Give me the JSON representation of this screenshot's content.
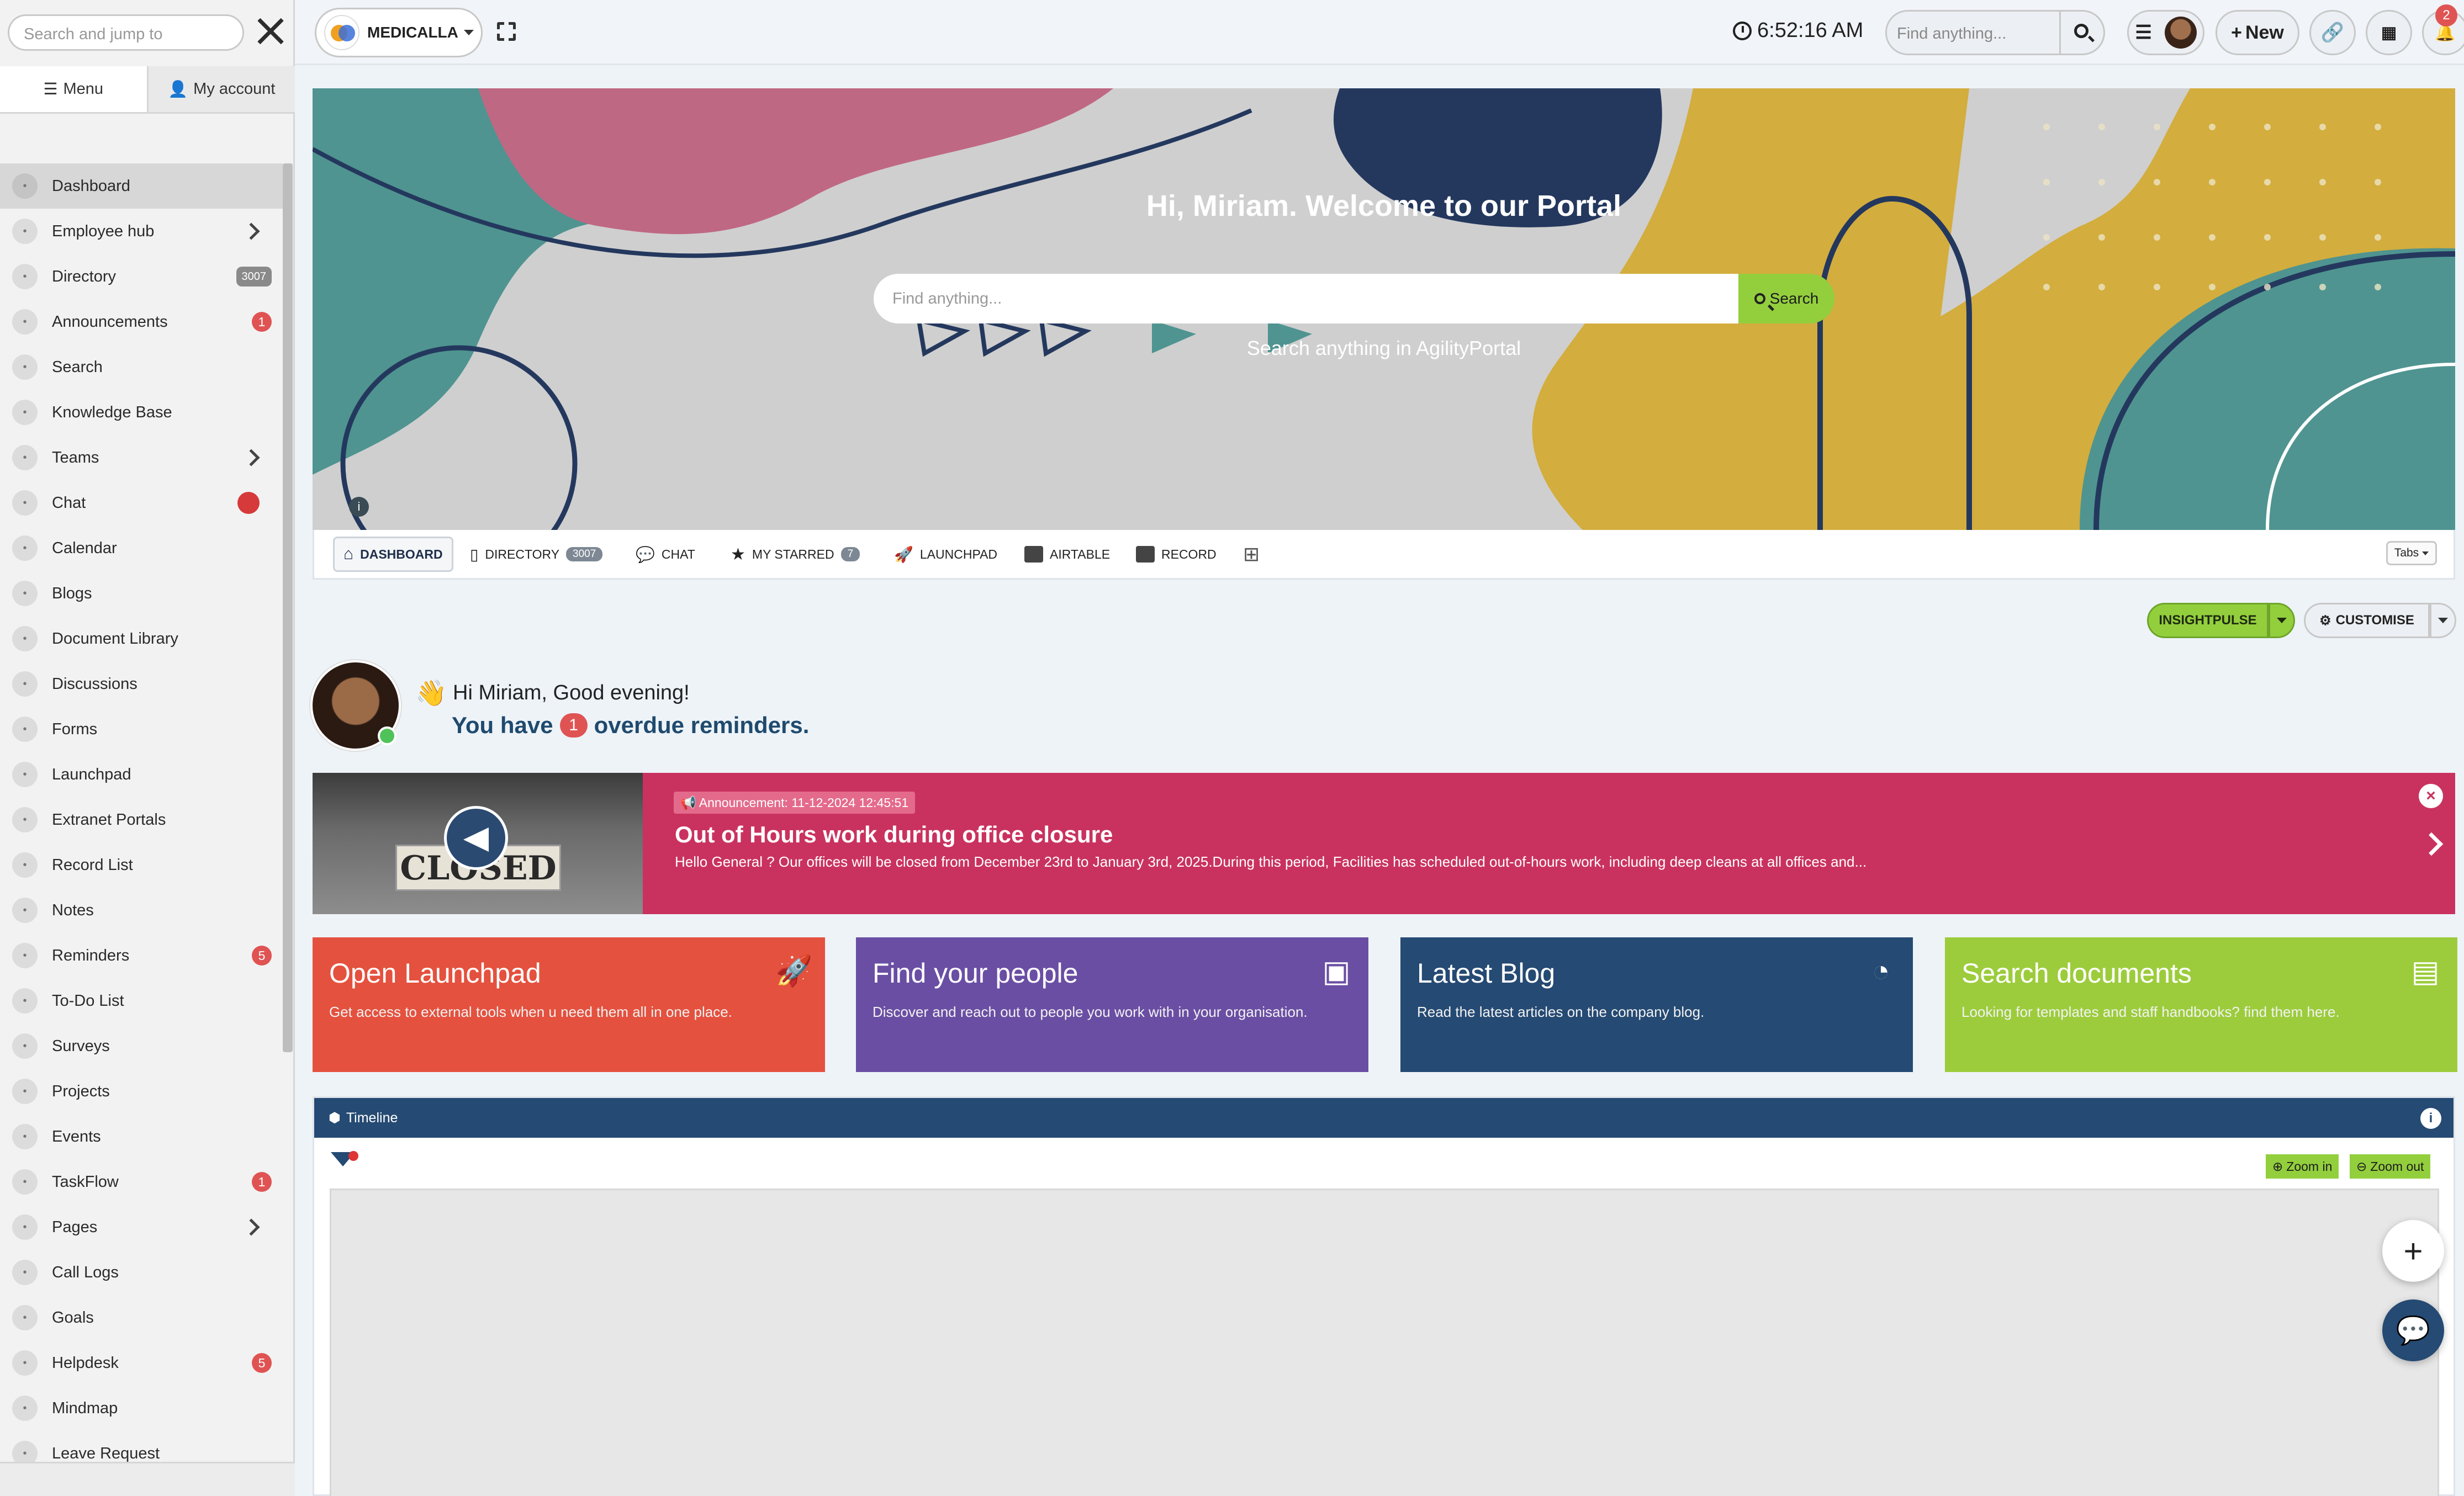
{
  "sidebar": {
    "search_placeholder": "Search and jump to",
    "tabs": [
      {
        "label": "Menu"
      },
      {
        "label": "My account"
      }
    ],
    "items": [
      {
        "label": "Dashboard",
        "icon": "dashboard-icon"
      },
      {
        "label": "Employee hub",
        "icon": "users-icon",
        "chevron": true
      },
      {
        "label": "Directory",
        "icon": "directory-icon",
        "badge": "3007"
      },
      {
        "label": "Announcements",
        "icon": "megaphone-icon",
        "badge": "1"
      },
      {
        "label": "Search",
        "icon": "search-icon"
      },
      {
        "label": "Knowledge Base",
        "icon": "folder-icon"
      },
      {
        "label": "Teams",
        "icon": "team-icon",
        "chevron": true
      },
      {
        "label": "Chat",
        "icon": "chat-icon",
        "dot": true
      },
      {
        "label": "Calendar",
        "icon": "calendar-icon"
      },
      {
        "label": "Blogs",
        "icon": "rss-icon"
      },
      {
        "label": "Document Library",
        "icon": "document-icon"
      },
      {
        "label": "Discussions",
        "icon": "comments-icon"
      },
      {
        "label": "Forms",
        "icon": "form-icon"
      },
      {
        "label": "Launchpad",
        "icon": "rocket-icon"
      },
      {
        "label": "Extranet Portals",
        "icon": "portal-icon"
      },
      {
        "label": "Record List",
        "icon": "table-icon"
      },
      {
        "label": "Notes",
        "icon": "note-icon"
      },
      {
        "label": "Reminders",
        "icon": "stopwatch-icon",
        "badge": "5"
      },
      {
        "label": "To-Do List",
        "icon": "list-icon"
      },
      {
        "label": "Surveys",
        "icon": "question-icon"
      },
      {
        "label": "Projects",
        "icon": "project-icon"
      },
      {
        "label": "Events",
        "icon": "event-icon"
      },
      {
        "label": "TaskFlow",
        "icon": "tasks-icon",
        "badge": "1"
      },
      {
        "label": "Pages",
        "icon": "page-icon",
        "chevron": true
      },
      {
        "label": "Call Logs",
        "icon": "phone-icon"
      },
      {
        "label": "Goals",
        "icon": "target-icon"
      },
      {
        "label": "Helpdesk",
        "icon": "life-ring-icon",
        "badge": "5"
      },
      {
        "label": "Mindmap",
        "icon": "brain-icon"
      },
      {
        "label": "Leave Request",
        "icon": "plane-icon"
      }
    ]
  },
  "topbar": {
    "org_name": "MEDICALLA",
    "time": "6:52:16 AM",
    "find_placeholder": "Find anything...",
    "new_label": "New",
    "notifications_count": "2"
  },
  "banner": {
    "title": "Hi, Miriam. Welcome to our Portal",
    "search_placeholder": "Find anything...",
    "search_button": "Search",
    "subtitle": "Search anything in AgilityPortal",
    "info": "i"
  },
  "tabs": [
    {
      "label": "DASHBOARD",
      "icon": "home-icon"
    },
    {
      "label": "DIRECTORY",
      "icon": "address-book-icon",
      "badge": "3007"
    },
    {
      "label": "CHAT",
      "icon": "chat-bubbles-icon"
    },
    {
      "label": "MY STARRED",
      "icon": "star-icon",
      "badge": "7"
    },
    {
      "label": "LAUNCHPAD",
      "icon": "rocket-icon"
    },
    {
      "label": "AIRTABLE",
      "icon": "square-icon"
    },
    {
      "label": "RECORD",
      "icon": "square-icon"
    }
  ],
  "tabs_dropdown": "Tabs",
  "actions": {
    "insightpulse": "INSIGHTPULSE",
    "customise": "CUSTOMISE"
  },
  "greeting": {
    "line1": "Hi Miriam, Good evening!",
    "line2_pre": "You have",
    "count": "1",
    "line2_post": "overdue reminders."
  },
  "announcement": {
    "tag": "Announcement: 11-12-2024 12:45:51",
    "title": "Out of Hours work during office closure",
    "text": "Hello General ? Our offices will be closed from December 23rd to January 3rd, 2025.During this period, Facilities has scheduled out-of-hours work, including deep cleans at all offices and...",
    "image_sign": "CLOSED"
  },
  "cards": [
    {
      "title": "Open Launchpad",
      "text": "Get access to external tools when u need them all in one place.",
      "color": "#e4513e",
      "icon": "rocket-icon"
    },
    {
      "title": "Find your people",
      "text": "Discover and reach out to people you work with in your organisation.",
      "color": "#6a4ea3",
      "icon": "address-card-icon"
    },
    {
      "title": "Latest Blog",
      "text": "Read the latest articles on the company blog.",
      "color": "#254a73",
      "icon": "rss-icon"
    },
    {
      "title": "Search documents",
      "text": "Looking for templates and staff handbooks? find them here.",
      "color": "#9ccc3c",
      "icon": "file-icon"
    }
  ],
  "timeline": {
    "title": "Timeline",
    "zoom_in": "Zoom in",
    "zoom_out": "Zoom out"
  },
  "colors": {
    "accent_green": "#93cf3d",
    "navy": "#254a73",
    "announcement_pink": "#c9325f",
    "badge_red": "#e05353"
  }
}
